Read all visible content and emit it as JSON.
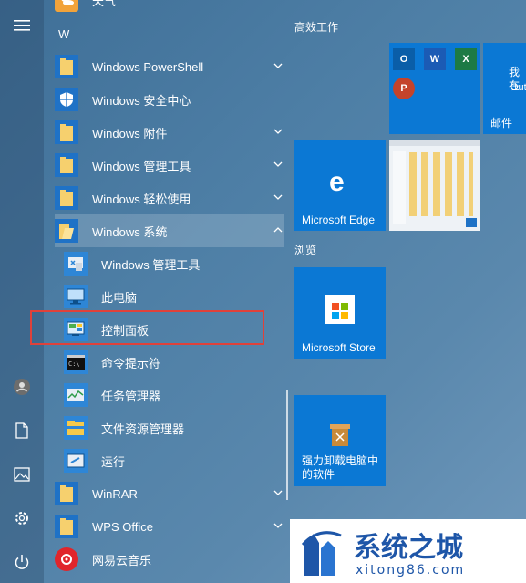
{
  "left_rail": {
    "icons": [
      "hamburger-menu-icon",
      "user-icon",
      "document-icon",
      "pictures-icon",
      "settings-icon",
      "power-icon"
    ]
  },
  "app_list": {
    "top_partial": "天气",
    "letter_header": "W",
    "items": [
      {
        "label": "Windows PowerShell",
        "icon": "folder-icon",
        "expandable": true
      },
      {
        "label": "Windows 安全中心",
        "icon": "shield-icon",
        "expandable": false
      },
      {
        "label": "Windows 附件",
        "icon": "folder-icon",
        "expandable": true
      },
      {
        "label": "Windows 管理工具",
        "icon": "folder-icon",
        "expandable": true
      },
      {
        "label": "Windows 轻松使用",
        "icon": "folder-icon",
        "expandable": true
      },
      {
        "label": "Windows 系统",
        "icon": "folder-icon",
        "expandable": true,
        "expanded": true
      },
      {
        "label": "Windows 管理工具",
        "icon": "admin-tools-icon",
        "sub": true
      },
      {
        "label": "此电脑",
        "icon": "this-pc-icon",
        "sub": true
      },
      {
        "label": "控制面板",
        "icon": "control-panel-icon",
        "sub": true,
        "highlighted": true
      },
      {
        "label": "命令提示符",
        "icon": "cmd-icon",
        "sub": true
      },
      {
        "label": "任务管理器",
        "icon": "task-manager-icon",
        "sub": true
      },
      {
        "label": "文件资源管理器",
        "icon": "file-explorer-icon",
        "sub": true
      },
      {
        "label": "运行",
        "icon": "run-icon",
        "sub": true
      },
      {
        "label": "WinRAR",
        "icon": "folder-icon",
        "expandable": true
      },
      {
        "label": "WPS Office",
        "icon": "folder-icon",
        "expandable": true
      },
      {
        "label": "网易云音乐",
        "icon": "netease-music-icon",
        "expandable": false
      }
    ]
  },
  "tiles": {
    "group1_title": "高效工作",
    "group2_title": "浏览",
    "office_badges": [
      "O",
      "W",
      "X",
      "P"
    ],
    "mail_title": "我在",
    "mail_sub": "Out",
    "mail_label": "邮件",
    "edge_label": "Microsoft Edge",
    "store_label": "Microsoft Store",
    "uninstall_label_line1": "强力卸载电脑中",
    "uninstall_label_line2": "的软件"
  },
  "watermark": {
    "title": "系统之城",
    "url": "xitong86.com"
  }
}
